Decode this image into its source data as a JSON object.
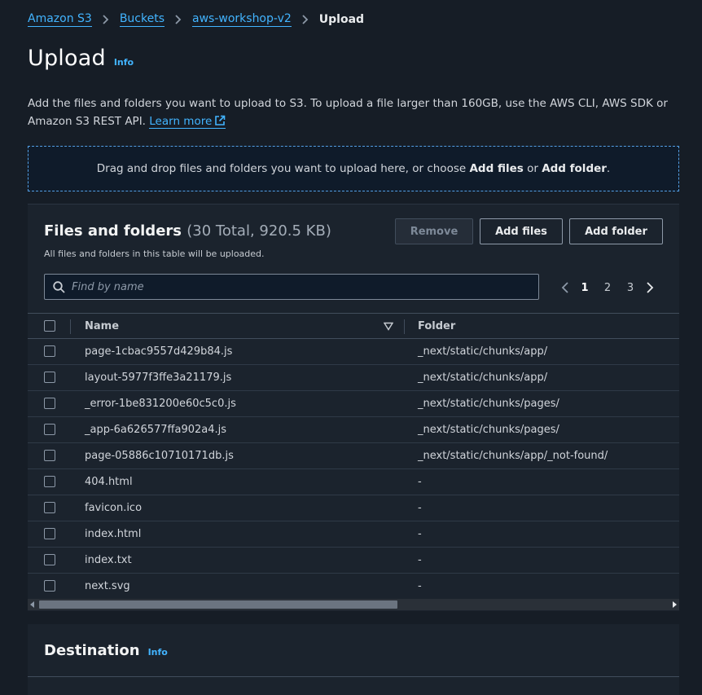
{
  "breadcrumb": {
    "items": [
      "Amazon S3",
      "Buckets",
      "aws-workshop-v2"
    ],
    "current": "Upload"
  },
  "header": {
    "title": "Upload",
    "info": "Info"
  },
  "description": {
    "text": "Add the files and folders you want to upload to S3. To upload a file larger than 160GB, use the AWS CLI, AWS SDK or Amazon S3 REST API.",
    "learn_more": "Learn more"
  },
  "dropzone": {
    "prefix": "Drag and drop files and folders you want to upload here, or choose",
    "add_files": "Add files",
    "or": "or",
    "add_folder": "Add folder",
    "suffix": "."
  },
  "files_panel": {
    "title": "Files and folders",
    "count": "(30 Total, 920.5 KB)",
    "subtitle": "All files and folders in this table will be uploaded.",
    "remove_label": "Remove",
    "add_files_label": "Add files",
    "add_folder_label": "Add folder",
    "search_placeholder": "Find by name",
    "pages": [
      "1",
      "2",
      "3"
    ],
    "current_page": "1",
    "columns": {
      "name": "Name",
      "folder": "Folder"
    },
    "rows": [
      {
        "name": "page-1cbac9557d429b84.js",
        "folder": "_next/static/chunks/app/"
      },
      {
        "name": "layout-5977f3ffe3a21179.js",
        "folder": "_next/static/chunks/app/"
      },
      {
        "name": "_error-1be831200e60c5c0.js",
        "folder": "_next/static/chunks/pages/"
      },
      {
        "name": "_app-6a626577ffa902a4.js",
        "folder": "_next/static/chunks/pages/"
      },
      {
        "name": "page-05886c10710171db.js",
        "folder": "_next/static/chunks/app/_not-found/"
      },
      {
        "name": "404.html",
        "folder": "-"
      },
      {
        "name": "favicon.ico",
        "folder": "-"
      },
      {
        "name": "index.html",
        "folder": "-"
      },
      {
        "name": "index.txt",
        "folder": "-"
      },
      {
        "name": "next.svg",
        "folder": "-"
      }
    ]
  },
  "destination": {
    "title": "Destination",
    "info": "Info"
  },
  "colors": {
    "background": "#161d26",
    "panel": "#1b232d",
    "link": "#42b4ff"
  }
}
